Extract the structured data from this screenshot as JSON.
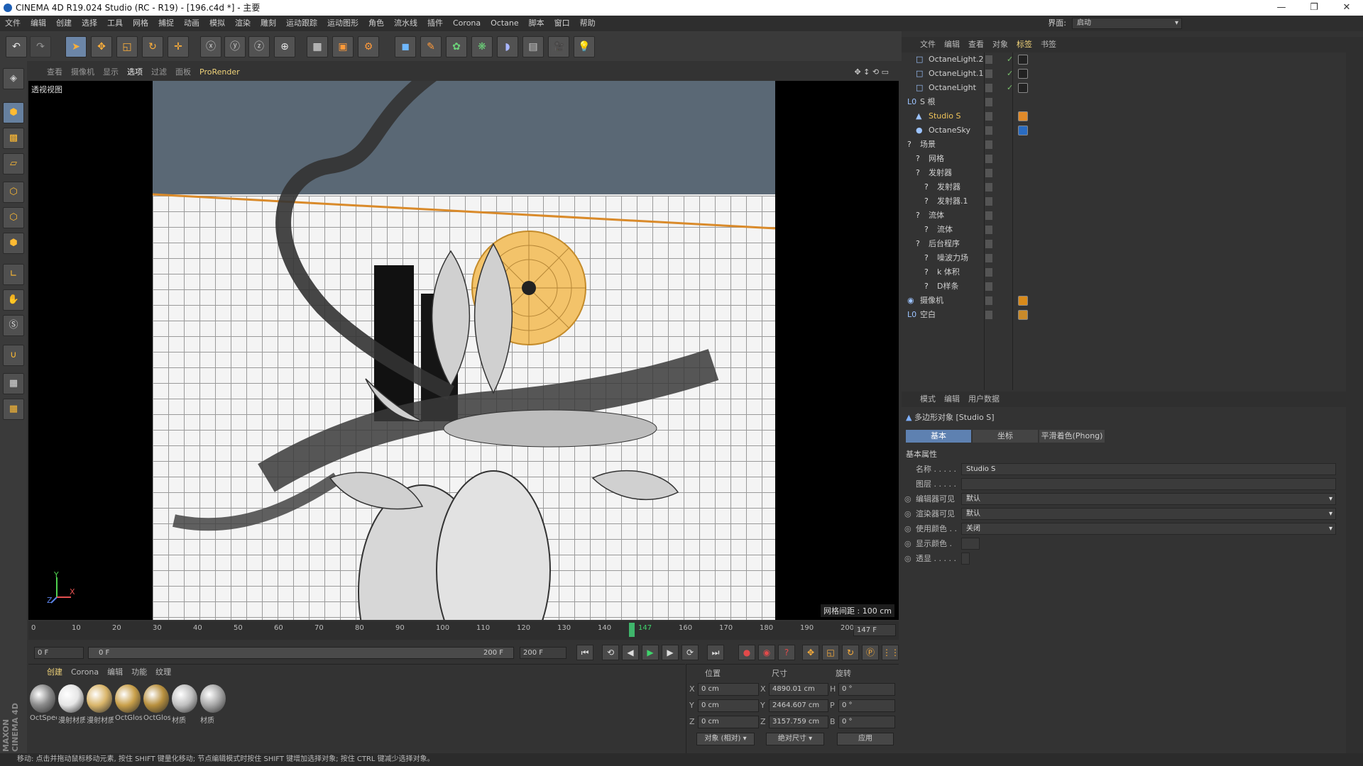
{
  "window": {
    "title": "CINEMA 4D R19.024 Studio (RC - R19) - [196.c4d *] - 主要",
    "minimize": "—",
    "maximize": "❐",
    "close": "✕"
  },
  "menubar": {
    "items": [
      "文件",
      "编辑",
      "创建",
      "选择",
      "工具",
      "网格",
      "捕捉",
      "动画",
      "模拟",
      "渲染",
      "雕刻",
      "运动跟踪",
      "运动图形",
      "角色",
      "流水线",
      "插件",
      "Corona",
      "Octane",
      "脚本",
      "窗口",
      "帮助"
    ],
    "interface_label": "界面:",
    "interface_value": "启动"
  },
  "viewport": {
    "menu": [
      "查看",
      "摄像机",
      "显示",
      "选项",
      "过滤",
      "面板",
      "ProRender"
    ],
    "active_menu": "选项",
    "label": "透视视图",
    "grid_spacing": "网格间距 : 100 cm",
    "axis_y": "Y",
    "axis_x": "X",
    "axis_z": "Z"
  },
  "timeline": {
    "ticks": [
      "0",
      "10",
      "20",
      "30",
      "40",
      "50",
      "60",
      "70",
      "80",
      "90",
      "100",
      "110",
      "120",
      "130",
      "140",
      "147",
      "160",
      "170",
      "180",
      "190",
      "200"
    ],
    "current_frame_marker": "147",
    "end_display": "147 F",
    "start_field": "0 F",
    "range_start": "0 F",
    "range_end": "200 F",
    "end_field": "200 F"
  },
  "materials": {
    "tabs": [
      "创建",
      "Corona",
      "编辑",
      "功能",
      "纹理"
    ],
    "items": [
      {
        "label": "OctSpec",
        "color": "#8a8a8a"
      },
      {
        "label": "漫射材质",
        "color": "#e6e6e6"
      },
      {
        "label": "漫射材质",
        "color": "#d9b56a"
      },
      {
        "label": "OctGlos",
        "color": "#c9a04a"
      },
      {
        "label": "OctGlos",
        "color": "#b8903e"
      },
      {
        "label": "材质",
        "color": "#c0c0c0"
      },
      {
        "label": "材质",
        "color": "#a8a8a8"
      }
    ]
  },
  "coords": {
    "headers": [
      "位置",
      "尺寸",
      "旋转"
    ],
    "rows": [
      {
        "axis": "X",
        "pos": "0 cm",
        "size_axis": "X",
        "size": "4890.01 cm",
        "rot_axis": "H",
        "rot": "0 °"
      },
      {
        "axis": "Y",
        "pos": "0 cm",
        "size_axis": "Y",
        "size": "2464.607 cm",
        "rot_axis": "P",
        "rot": "0 °"
      },
      {
        "axis": "Z",
        "pos": "0 cm",
        "size_axis": "Z",
        "size": "3157.759 cm",
        "rot_axis": "B",
        "rot": "0 °"
      }
    ],
    "mode1": "对象 (相对)",
    "mode2": "绝对尺寸",
    "apply": "应用"
  },
  "object_manager": {
    "menu": [
      "文件",
      "编辑",
      "查看",
      "对象",
      "标签",
      "书签"
    ],
    "active_menu": "标签",
    "objects": [
      {
        "name": "OctaneLight.2",
        "indent": 1,
        "icon": "□",
        "tag_color": "#222"
      },
      {
        "name": "OctaneLight.1",
        "indent": 1,
        "icon": "□",
        "tag_color": "#222"
      },
      {
        "name": "OctaneLight",
        "indent": 1,
        "icon": "□",
        "tag_color": "#222"
      },
      {
        "name": "S 根",
        "indent": 0,
        "icon": "L0",
        "tag_color": ""
      },
      {
        "name": "Studio S",
        "indent": 1,
        "icon": "▲",
        "tag_color": "#e08a2a"
      },
      {
        "name": "OctaneSky",
        "indent": 1,
        "icon": "●",
        "tag_color": "#2a6cc2"
      },
      {
        "name": "场景",
        "indent": 0,
        "icon": "?",
        "tag_color": ""
      },
      {
        "name": "网格",
        "indent": 1,
        "icon": "?",
        "tag_color": ""
      },
      {
        "name": "发射器",
        "indent": 1,
        "icon": "?",
        "tag_color": ""
      },
      {
        "name": "发射器",
        "indent": 2,
        "icon": "?",
        "tag_color": ""
      },
      {
        "name": "发射器.1",
        "indent": 2,
        "icon": "?",
        "tag_color": ""
      },
      {
        "name": "流体",
        "indent": 1,
        "icon": "?",
        "tag_color": ""
      },
      {
        "name": "流体",
        "indent": 2,
        "icon": "?",
        "tag_color": ""
      },
      {
        "name": "后台程序",
        "indent": 1,
        "icon": "?",
        "tag_color": ""
      },
      {
        "name": "噪波力场",
        "indent": 2,
        "icon": "?",
        "tag_color": ""
      },
      {
        "name": "k 体积",
        "indent": 2,
        "icon": "?",
        "tag_color": ""
      },
      {
        "name": "D样条",
        "indent": 2,
        "icon": "?",
        "tag_color": ""
      },
      {
        "name": "摄像机",
        "indent": 0,
        "icon": "◉",
        "tag_color": "#d98a1a"
      },
      {
        "name": "空白",
        "indent": 0,
        "icon": "L0",
        "tag_color": "#c98a2a"
      }
    ]
  },
  "attributes": {
    "menu": [
      "模式",
      "编辑",
      "用户数据"
    ],
    "object_title": "多边形对象 [Studio S]",
    "tabs": [
      "基本",
      "坐标",
      "平滑着色(Phong)"
    ],
    "section": "基本属性",
    "fields": [
      {
        "label": "名称 . . . . .",
        "value": "Studio S"
      },
      {
        "label": "图层 . . . . .",
        "value": ""
      },
      {
        "label": "编辑器可见",
        "value": "默认"
      },
      {
        "label": "渲染器可见",
        "value": "默认"
      },
      {
        "label": "使用颜色 . .",
        "value": "关闭"
      },
      {
        "label": "显示颜色 .",
        "value": ""
      },
      {
        "label": "透显 . . . . .",
        "value": ""
      }
    ]
  },
  "status": "移动: 点击并拖动鼠标移动元素, 按住 SHIFT 键量化移动; 节点编辑模式时按住 SHIFT 键增加选择对象; 按住 CTRL 键减少选择对象。",
  "brand": "MAXON CINEMA 4D"
}
